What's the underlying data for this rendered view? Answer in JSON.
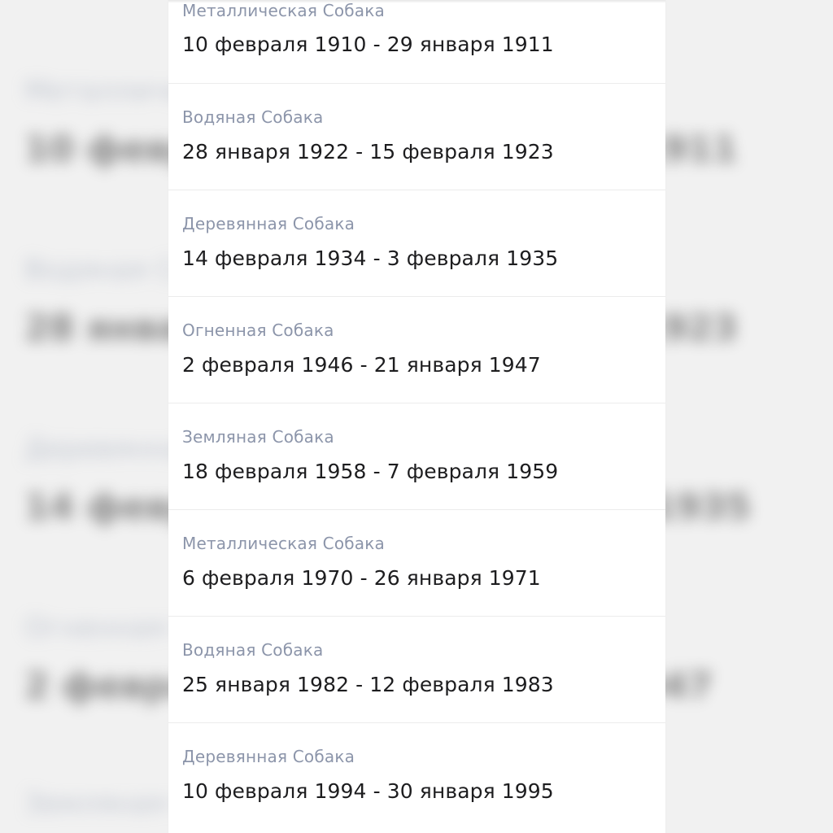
{
  "entries": [
    {
      "title": "Металлическая Собака",
      "dates": "10 февраля 1910 - 29 января 1911"
    },
    {
      "title": "Водяная Собака",
      "dates": "28 января 1922 - 15 февраля 1923"
    },
    {
      "title": "Деревянная Собака",
      "dates": "14 февраля 1934 - 3 февраля 1935"
    },
    {
      "title": "Огненная Собака",
      "dates": "2 февраля 1946 - 21 января 1947"
    },
    {
      "title": "Земляная Собака",
      "dates": "18 февраля 1958 - 7 февраля 1959"
    },
    {
      "title": "Металлическая Собака",
      "dates": "6 февраля 1970 - 26 января 1971"
    },
    {
      "title": "Водяная Собака",
      "dates": "25 января 1982 - 12 февраля 1983"
    },
    {
      "title": "Деревянная Собака",
      "dates": "10 февраля 1994 - 30 января 1995"
    }
  ]
}
